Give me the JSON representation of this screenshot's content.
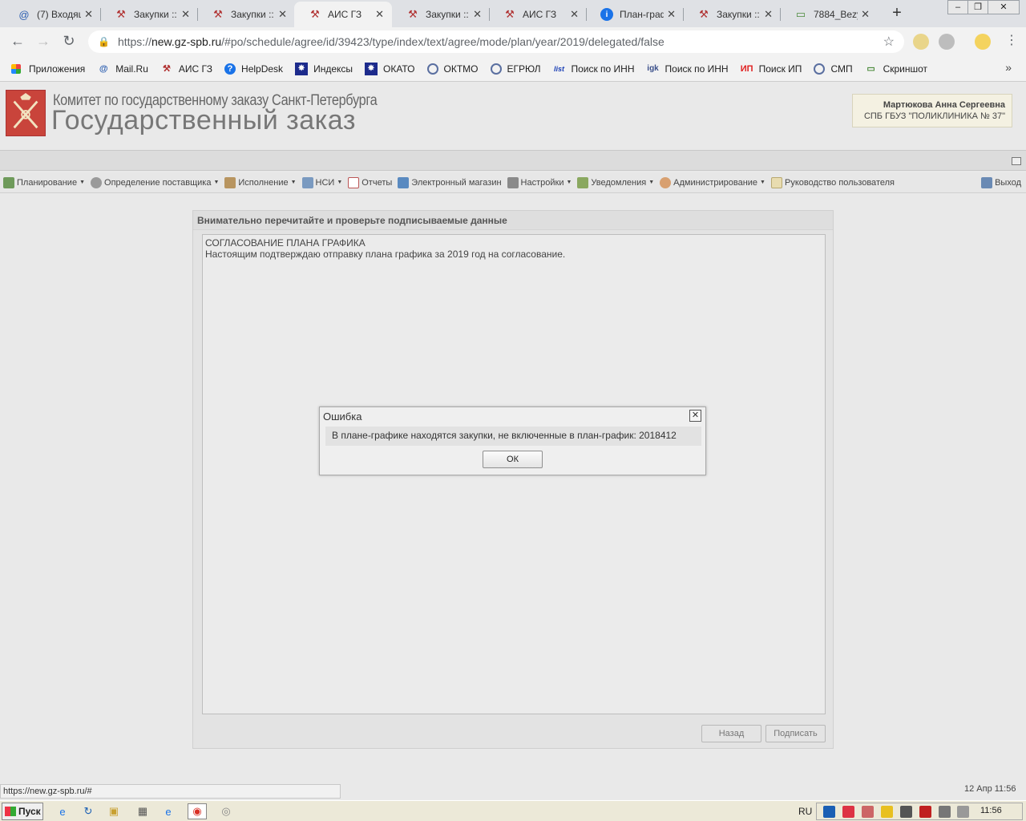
{
  "browser": {
    "tabs": [
      {
        "title": "(7) Входящ",
        "icon": "mail-icon"
      },
      {
        "title": "Закупки ::",
        "icon": "hammer-icon"
      },
      {
        "title": "Закупки ::",
        "icon": "hammer-icon"
      },
      {
        "title": "АИС ГЗ",
        "icon": "hammer-icon"
      },
      {
        "title": "Закупки ::",
        "icon": "hammer-icon"
      },
      {
        "title": "АИС ГЗ",
        "icon": "hammer-icon"
      },
      {
        "title": "План-граф",
        "icon": "info-icon"
      },
      {
        "title": "Закупки ::",
        "icon": "hammer-icon"
      },
      {
        "title": "7884_Bezyı",
        "icon": "image-icon"
      }
    ],
    "new_tab": "+",
    "url_prefix": "https://",
    "url_host": "new.gz-spb.ru",
    "url_path": "/#po/schedule/agree/id/39423/type/index/text/agree/mode/plan/year/2019/delegated/false",
    "bookmarks": [
      {
        "label": "Приложения",
        "icon": "apps-grid-icon"
      },
      {
        "label": "Mail.Ru",
        "icon": "mail-icon"
      },
      {
        "label": "АИС ГЗ",
        "icon": "hammer-icon"
      },
      {
        "label": "HelpDesk",
        "icon": "help-icon"
      },
      {
        "label": "Индексы",
        "icon": "star-badge-icon"
      },
      {
        "label": "ОКАТО",
        "icon": "star-badge-icon"
      },
      {
        "label": "ОКТМО",
        "icon": "emblem-icon"
      },
      {
        "label": "ЕГРЮЛ",
        "icon": "emblem-icon"
      },
      {
        "label": "Поиск по ИНН",
        "icon": "listorg-icon",
        "icon_text": "list"
      },
      {
        "label": "Поиск по ИНН",
        "icon": "igk-icon",
        "icon_text": "igk"
      },
      {
        "label": "Поиск ИП",
        "icon": "ip-icon",
        "icon_text": "ИП"
      },
      {
        "label": "СМП",
        "icon": "emblem-icon"
      },
      {
        "label": "Скриншот",
        "icon": "image-icon"
      }
    ],
    "bookmarks_more": "»"
  },
  "site": {
    "org": "Комитет по государственному заказу Санкт-Петербурга",
    "title": "Государственный заказ",
    "user_name": "Мартюкова Анна Сергеевна",
    "user_org": "СПБ ГБУЗ \"ПОЛИКЛИНИКА № 37\""
  },
  "menu": {
    "items": [
      {
        "label": "Планирование",
        "dropdown": true
      },
      {
        "label": "Определение поставщика",
        "dropdown": true
      },
      {
        "label": "Исполнение",
        "dropdown": true
      },
      {
        "label": "НСИ",
        "dropdown": true
      },
      {
        "label": "Отчеты",
        "dropdown": false
      },
      {
        "label": "Электронный магазин",
        "dropdown": false
      },
      {
        "label": "Настройки",
        "dropdown": true
      },
      {
        "label": "Уведомления",
        "dropdown": true
      },
      {
        "label": "Администрирование",
        "dropdown": true
      },
      {
        "label": "Руководство пользователя",
        "dropdown": false
      }
    ],
    "logout": "Выход"
  },
  "panel": {
    "header": "Внимательно перечитайте и проверьте подписываемые данные",
    "line1": "СОГЛАСОВАНИЕ ПЛАНА ГРАФИКА",
    "line2": "Настоящим подтверждаю отправку плана графика за 2019 год на согласование.",
    "back_button": "Назад",
    "sign_button": "Подписать"
  },
  "dialog": {
    "title": "Ошибка",
    "message": "В плане-графике находятся закупки, не включенные в план-график: 2018412",
    "ok": "ОК"
  },
  "status": {
    "url": "https://new.gz-spb.ru/#",
    "date": "12 Апр 11:56"
  },
  "taskbar": {
    "start": "Пуск",
    "lang": "RU",
    "clock": "11:56"
  },
  "colors": {
    "crest": "#c9443b",
    "chrome_bar": "#dfe1e5",
    "page_bg": "#e9e9e9"
  }
}
